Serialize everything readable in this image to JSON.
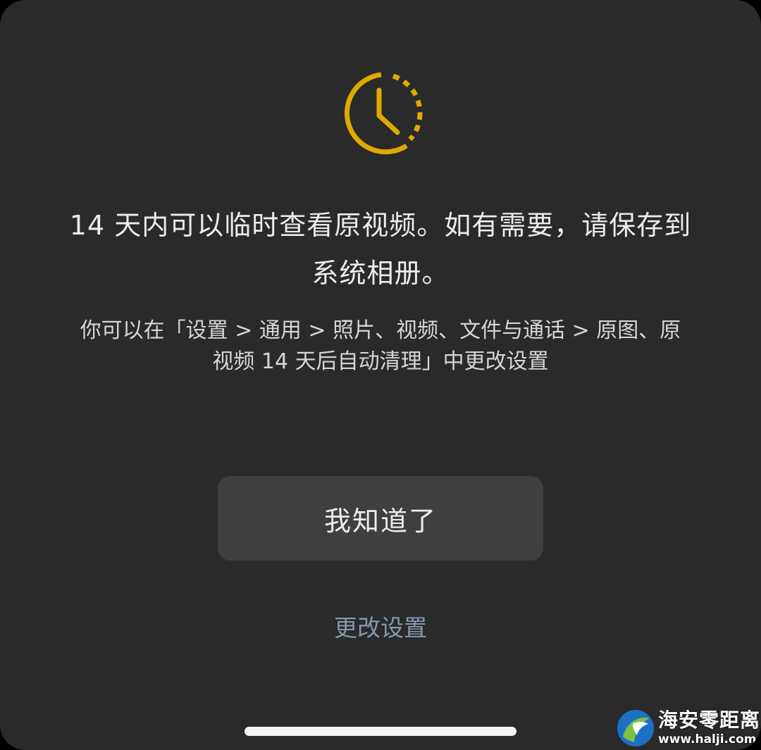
{
  "dialog": {
    "icon": "clock-timer-icon",
    "accent_color": "#e0a800",
    "headline_line1": "14 天内可以临时查看原视频。如有需要，请保存到",
    "headline_line2": "系统相册。",
    "subtext_line1": "你可以在「设置 > 通用 > 照片、视频、文件与通话 > 原图、原",
    "subtext_line2": "视频 14 天后自动清理」中更改设置",
    "ok_button_label": "我知道了",
    "change_settings_label": "更改设置",
    "link_color": "#8796ad"
  },
  "watermark": {
    "title": "海安零距离",
    "url": "www.halji.com"
  }
}
